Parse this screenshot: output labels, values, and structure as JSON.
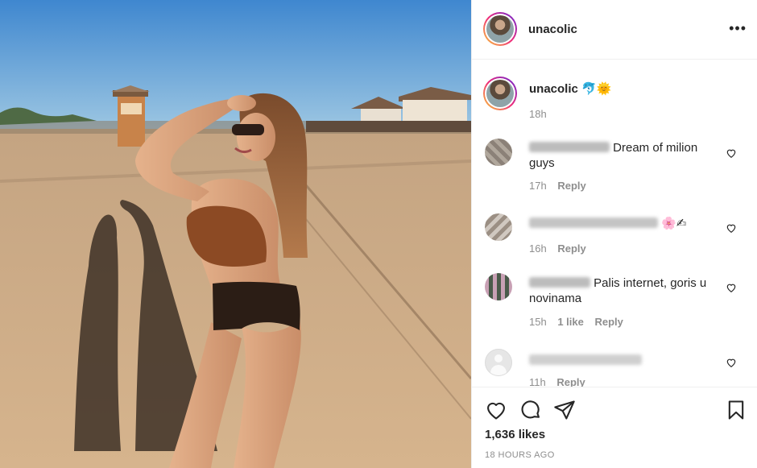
{
  "post": {
    "author": "unacolic",
    "author_avatar_icon": "profile-avatar",
    "more_icon": "more-options-icon",
    "more_glyph": "•••"
  },
  "caption": {
    "username": "unacolic",
    "emoji": "🐬🌞",
    "time": "18h"
  },
  "comments": [
    {
      "username_hidden": true,
      "text": "Dream of milion guys",
      "time": "17h",
      "reply": "Reply"
    },
    {
      "username_hidden": true,
      "text": "🌸✍",
      "time": "16h",
      "reply": "Reply"
    },
    {
      "username_hidden": true,
      "text": "Palis internet, goris u novinama",
      "time": "15h",
      "likes": "1 like",
      "reply": "Reply"
    },
    {
      "username_hidden": true,
      "text": "",
      "time": "11h",
      "reply": "Reply"
    }
  ],
  "actions": {
    "like_icon": "heart-icon",
    "comment_icon": "comment-icon",
    "share_icon": "share-icon",
    "save_icon": "bookmark-icon"
  },
  "stats": {
    "likes": "1,636 likes",
    "posted": "18 HOURS AGO"
  },
  "colors": {
    "text": "#262626",
    "muted": "#8e8e8e",
    "border": "#efefef",
    "story_ring_start": "#f9ce34",
    "story_ring_mid": "#ee2a7b",
    "story_ring_end": "#6228d7"
  }
}
